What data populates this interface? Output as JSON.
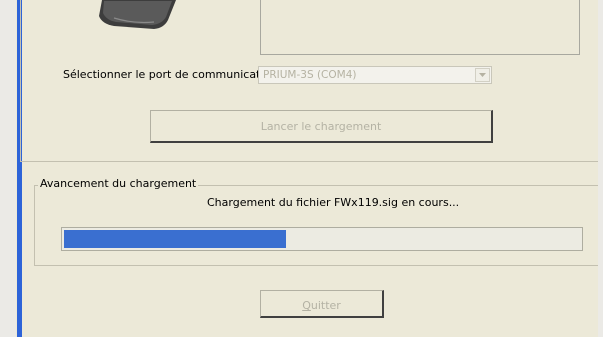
{
  "port": {
    "label": "Sélectionner le port de communication :",
    "selected": "PRIUM-3S (COM4)"
  },
  "load_button": {
    "label": "Lancer le chargement"
  },
  "progress": {
    "group_title": "Avancement du chargement",
    "status": "Chargement du fichier FWx119.sig en cours...",
    "fraction": 0.43
  },
  "quit_button": {
    "label": "Quitter"
  },
  "colors": {
    "progress_fill": "#3a6fd0",
    "window_border": "#2d63d8",
    "background": "#ece9d8"
  }
}
